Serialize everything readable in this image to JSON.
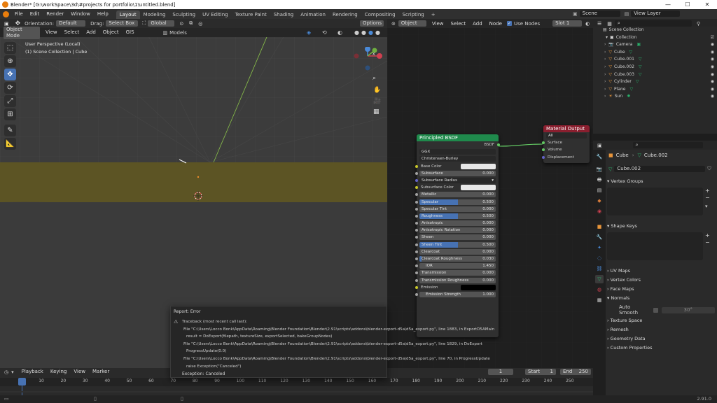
{
  "title_bar": {
    "title": "Blender* [G:\\workSpace\\3d\\#projects for portfolio\\1\\untitled.blend]",
    "minimize": "—",
    "maximize": "☐",
    "close": "✕"
  },
  "menu": {
    "items": [
      "File",
      "Edit",
      "Render",
      "Window",
      "Help"
    ]
  },
  "workspaces": [
    "Layout",
    "Modeling",
    "Sculpting",
    "UV Editing",
    "Texture Paint",
    "Shading",
    "Animation",
    "Rendering",
    "Compositing",
    "Scripting",
    "+"
  ],
  "scene": {
    "name": "Scene",
    "view_layer": "View Layer"
  },
  "viewport": {
    "orientation_label": "Orientation:",
    "orientation": "Default",
    "drag_label": "Drag:",
    "drag": "Select Box",
    "transform": "Global",
    "mode": "Object Mode",
    "menus": [
      "View",
      "Select",
      "Add",
      "Object",
      "GIS"
    ],
    "models_label": "Models",
    "options": "Options",
    "overlay_title": "User Perspective (Local)",
    "overlay_sub": "(1) Scene Collection | Cube",
    "gizmo": {
      "x": "X",
      "y": "Y",
      "z": "Z"
    }
  },
  "node_editor": {
    "type": "Object",
    "menus": [
      "View",
      "Select",
      "Add",
      "Node"
    ],
    "use_nodes": "Use Nodes",
    "slot": "Slot 1",
    "bsdf": {
      "title": "Principled BSDF",
      "output": "BSDF",
      "distribution": "GGX",
      "subsurface_method": "Christensen-Burley",
      "rows": [
        {
          "label": "Base Color",
          "value": "",
          "kind": "color",
          "sock": "sy"
        },
        {
          "label": "Subsurface",
          "value": "0.000",
          "kind": "slider",
          "fill": 0,
          "sock": "sg"
        },
        {
          "label": "Subsurface Radius",
          "value": "",
          "kind": "dropdown",
          "sock": "sp"
        },
        {
          "label": "Subsurface Color",
          "value": "",
          "kind": "color",
          "sock": "sy"
        },
        {
          "label": "Metallic",
          "value": "0.000",
          "kind": "slider",
          "fill": 0,
          "sock": "sg"
        },
        {
          "label": "Specular",
          "value": "0.500",
          "kind": "slider",
          "fill": 0.5,
          "sock": "sg"
        },
        {
          "label": "Specular Tint",
          "value": "0.000",
          "kind": "slider",
          "fill": 0,
          "sock": "sg"
        },
        {
          "label": "Roughness",
          "value": "0.500",
          "kind": "slider",
          "fill": 0.5,
          "sock": "sg"
        },
        {
          "label": "Anisotropic",
          "value": "0.000",
          "kind": "slider",
          "fill": 0,
          "sock": "sg"
        },
        {
          "label": "Anisotropic Rotation",
          "value": "0.000",
          "kind": "slider",
          "fill": 0,
          "sock": "sg"
        },
        {
          "label": "Sheen",
          "value": "0.000",
          "kind": "slider",
          "fill": 0,
          "sock": "sg"
        },
        {
          "label": "Sheen Tint",
          "value": "0.500",
          "kind": "slider",
          "fill": 0.5,
          "sock": "sg"
        },
        {
          "label": "Clearcoat",
          "value": "0.000",
          "kind": "slider",
          "fill": 0,
          "sock": "sg"
        },
        {
          "label": "Clearcoat Roughness",
          "value": "0.030",
          "kind": "slider",
          "fill": 0.03,
          "sock": "sg"
        },
        {
          "label": "IOR",
          "value": "1.450",
          "kind": "field",
          "sock": "sg"
        },
        {
          "label": "Transmission",
          "value": "0.000",
          "kind": "slider",
          "fill": 0,
          "sock": "sg"
        },
        {
          "label": "Transmission Roughness",
          "value": "0.000",
          "kind": "slider",
          "fill": 0,
          "sock": "sg"
        },
        {
          "label": "Emission",
          "value": "",
          "kind": "black",
          "sock": "sy"
        },
        {
          "label": "Emission Strength",
          "value": "1.000",
          "kind": "field",
          "sock": "sg"
        }
      ]
    },
    "material_output": {
      "title": "Material Output",
      "target": "All",
      "sockets": [
        "Surface",
        "Volume",
        "Displacement"
      ]
    }
  },
  "outliner": {
    "root": "Scene Collection",
    "collection": "Collection",
    "items": [
      "Camera",
      "Cube",
      "Cube.001",
      "Cube.002",
      "Cube.003",
      "Cylinder",
      "Plane",
      "Sun"
    ]
  },
  "properties": {
    "object": "Cube",
    "mesh": "Cube.002",
    "mesh_field": "Cube.002",
    "sections": [
      "Vertex Groups",
      "Shape Keys",
      "UV Maps",
      "Vertex Colors",
      "Face Maps",
      "Normals"
    ],
    "auto_smooth": "Auto Smooth",
    "auto_smooth_angle": "30°",
    "sections2": [
      "Texture Space",
      "Remesh",
      "Geometry Data",
      "Custom Properties"
    ]
  },
  "report": {
    "title": "Report: Error",
    "lines": [
      "Traceback (most recent call last):",
      "File \"C:\\Users\\Locco Bonk\\AppData\\Roaming\\Blender Foundation\\Blender\\2.91\\scripts\\addons\\blender-export-d5a\\d5a_export.py\", line 1883, in ExportD5AMain",
      "result = DoExport(filepath, textureSize, exportSelected, bakeGroupNodes)",
      "File \"C:\\Users\\Locco Bonk\\AppData\\Roaming\\Blender Foundation\\Blender\\2.91\\scripts\\addons\\blender-export-d5a\\d5a_export.py\", line 1829, in DoExport",
      "ProgressUpdate(0.0)",
      "File \"C:\\Users\\Locco Bonk\\AppData\\Roaming\\Blender Foundation\\Blender\\2.91\\scripts\\addons\\blender-export-d5a\\d5a_export.py\", line 70, in ProgressUpdate",
      "raise Exception(\"Canceled\")"
    ],
    "footer": "Exception: Canceled"
  },
  "timeline": {
    "menus": [
      "Playback",
      "Keying",
      "View",
      "Marker"
    ],
    "current": "1",
    "start_label": "Start",
    "start": "1",
    "end_label": "End",
    "end": "250",
    "ticks": [
      "1",
      "10",
      "20",
      "30",
      "40",
      "50",
      "60",
      "70",
      "80",
      "90",
      "100",
      "110",
      "120",
      "130",
      "140",
      "150",
      "160",
      "170",
      "180",
      "190",
      "200",
      "210",
      "220",
      "230",
      "240",
      "250"
    ]
  },
  "status": {
    "version": "2.91.0"
  },
  "colors": {
    "accent": "#4772b3",
    "bsdf_header": "#1f8a4c",
    "output_header": "#8a1f2f",
    "outliner_tri": "#2ab06b",
    "object_icon": "#e8953a"
  }
}
